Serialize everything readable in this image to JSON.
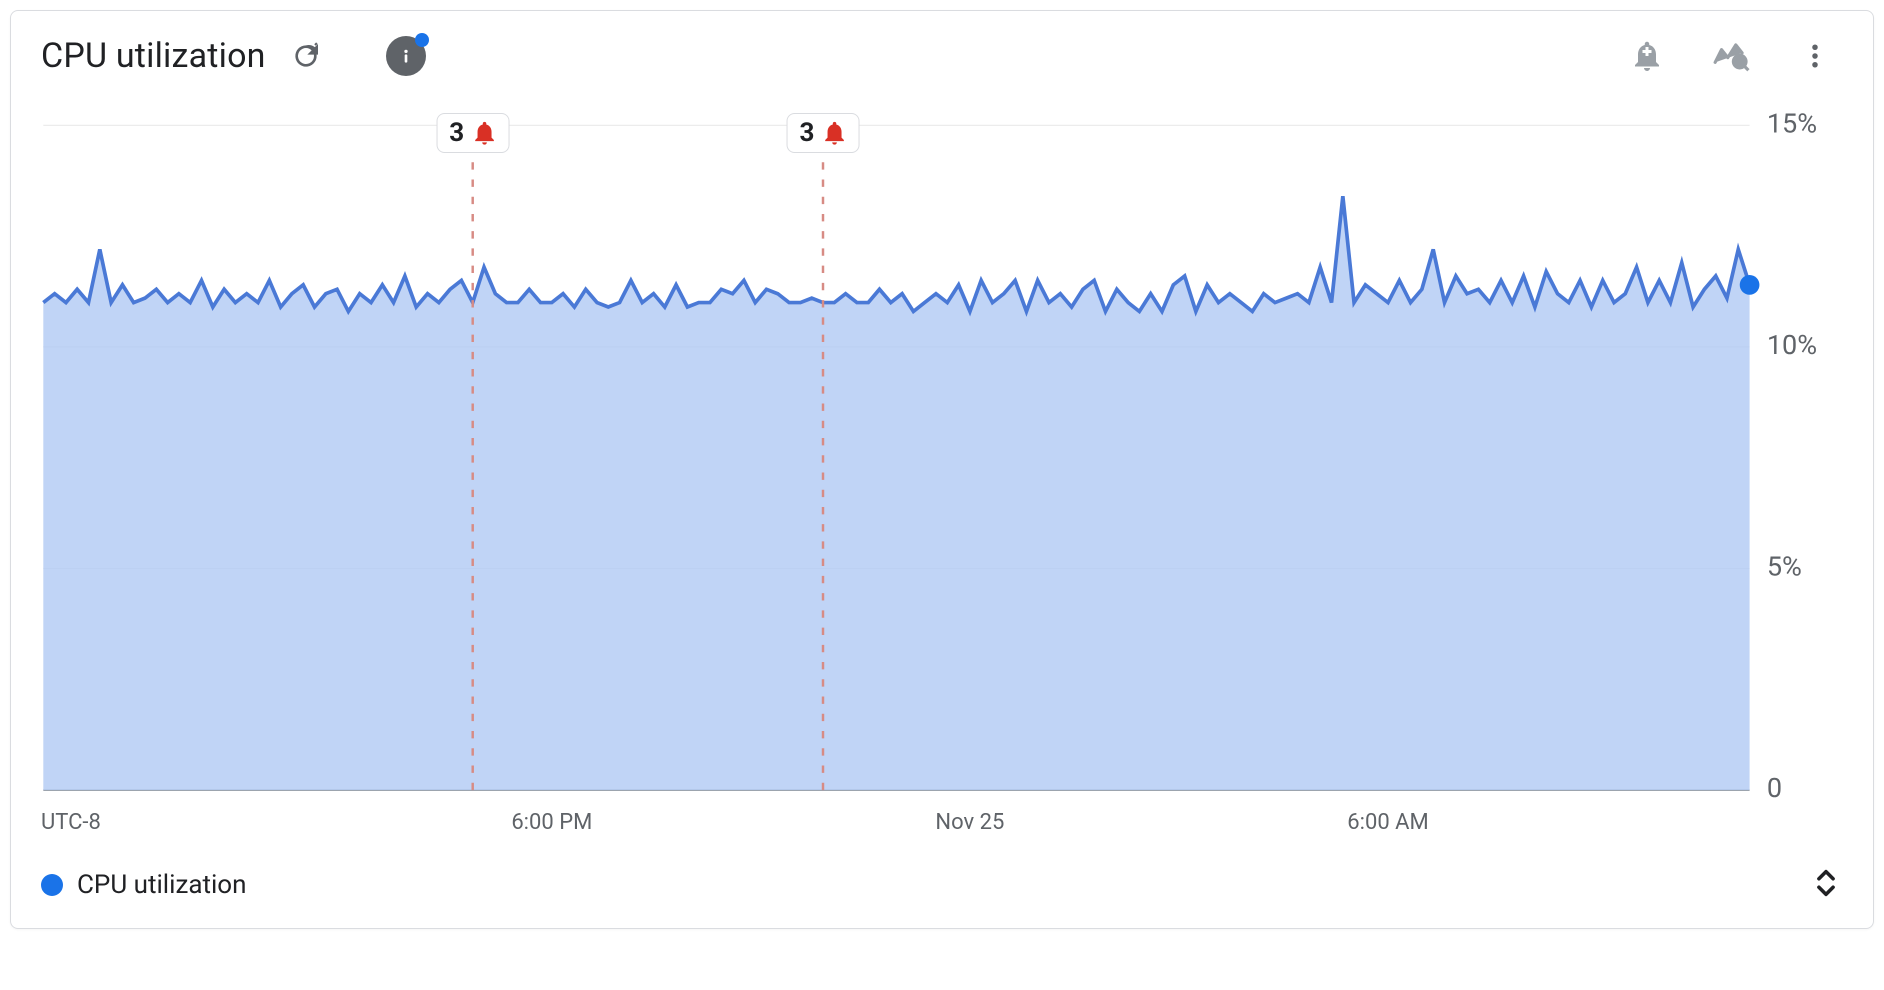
{
  "header": {
    "title": "CPU utilization"
  },
  "icons": {
    "refresh": "refresh-icon",
    "info": "info-icon",
    "add_alert": "add-alert-icon",
    "metrics_explorer": "metrics-explorer-icon",
    "more": "more-vert-icon",
    "alert_bell": "bell-icon",
    "sorter": "sort-icon"
  },
  "alerts": [
    {
      "x_index": 38,
      "count": 3
    },
    {
      "x_index": 69,
      "count": 3
    }
  ],
  "y_ticks": [
    {
      "v": 0,
      "label": "0"
    },
    {
      "v": 5,
      "label": "5%"
    },
    {
      "v": 10,
      "label": "10%"
    },
    {
      "v": 15,
      "label": "15%"
    }
  ],
  "x_axis": {
    "tz_label": "UTC-8",
    "ticks": [
      {
        "x_index": 45,
        "label": "6:00 PM"
      },
      {
        "x_index": 82,
        "label": "Nov 25"
      },
      {
        "x_index": 119,
        "label": "6:00 AM"
      }
    ]
  },
  "legend": {
    "series_name": "CPU utilization"
  },
  "chart_data": {
    "type": "area",
    "title": "CPU utilization",
    "xlabel": "",
    "ylabel": "",
    "ylim": [
      0,
      15
    ],
    "x_range_hours": 24,
    "series": [
      {
        "name": "CPU utilization",
        "values": [
          11.0,
          11.2,
          11.0,
          11.3,
          11.0,
          12.2,
          11.0,
          11.4,
          11.0,
          11.1,
          11.3,
          11.0,
          11.2,
          11.0,
          11.5,
          10.9,
          11.3,
          11.0,
          11.2,
          11.0,
          11.5,
          10.9,
          11.2,
          11.4,
          10.9,
          11.2,
          11.3,
          10.8,
          11.2,
          11.0,
          11.4,
          11.0,
          11.6,
          10.9,
          11.2,
          11.0,
          11.3,
          11.5,
          11.0,
          11.8,
          11.2,
          11.0,
          11.0,
          11.3,
          11.0,
          11.0,
          11.2,
          10.9,
          11.3,
          11.0,
          10.9,
          11.0,
          11.5,
          11.0,
          11.2,
          10.9,
          11.4,
          10.9,
          11.0,
          11.0,
          11.3,
          11.2,
          11.5,
          11.0,
          11.3,
          11.2,
          11.0,
          11.0,
          11.1,
          11.0,
          11.0,
          11.2,
          11.0,
          11.0,
          11.3,
          11.0,
          11.2,
          10.8,
          11.0,
          11.2,
          11.0,
          11.4,
          10.8,
          11.5,
          11.0,
          11.2,
          11.5,
          10.8,
          11.5,
          11.0,
          11.2,
          10.9,
          11.3,
          11.5,
          10.8,
          11.3,
          11.0,
          10.8,
          11.2,
          10.8,
          11.4,
          11.6,
          10.8,
          11.4,
          11.0,
          11.2,
          11.0,
          10.8,
          11.2,
          11.0,
          11.1,
          11.2,
          11.0,
          11.8,
          11.0,
          13.4,
          11.0,
          11.4,
          11.2,
          11.0,
          11.5,
          11.0,
          11.3,
          12.2,
          11.0,
          11.6,
          11.2,
          11.3,
          11.0,
          11.5,
          11.0,
          11.6,
          10.9,
          11.7,
          11.2,
          11.0,
          11.5,
          10.9,
          11.5,
          11.0,
          11.2,
          11.8,
          11.0,
          11.5,
          11.0,
          11.9,
          10.9,
          11.3,
          11.6,
          11.1,
          12.2,
          11.4
        ]
      }
    ]
  }
}
